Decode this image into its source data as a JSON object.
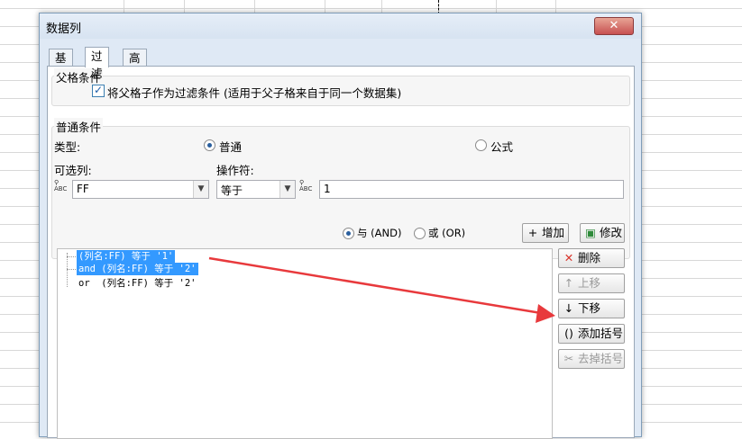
{
  "dialog": {
    "title": "数据列",
    "close_label": "✕"
  },
  "tabs": [
    {
      "label": "基本"
    },
    {
      "label": "过滤"
    },
    {
      "label": "高级"
    }
  ],
  "parent_condition": {
    "legend": "父格条件",
    "checkbox_checked": true,
    "checkbox_label": "将父格子作为过滤条件 (适用于父子格来自于同一个数据集)"
  },
  "normal_condition": {
    "legend": "普通条件",
    "type_label": "类型:",
    "type_options": [
      {
        "label": "普通",
        "selected": true
      },
      {
        "label": "公式",
        "selected": false
      }
    ],
    "column_label": "可选列:",
    "column_value": "FF",
    "operator_label": "操作符:",
    "operator_value": "等于",
    "value_value": "1"
  },
  "logic": {
    "and_label": "与 (AND)",
    "and_selected": true,
    "or_label": "或 (OR)",
    "or_selected": false
  },
  "buttons": {
    "add": "增加",
    "modify": "修改",
    "delete": "删除",
    "move_up": "上移",
    "move_down": "下移",
    "add_bracket": "添加括号",
    "remove_bracket": "去掉括号"
  },
  "conditions": [
    {
      "connector": "",
      "text": "(列名:FF) 等于 '1'",
      "selected": true
    },
    {
      "connector": "",
      "text": "and (列名:FF) 等于 '2'",
      "selected": true
    },
    {
      "connector": "",
      "text": "or  (列名:FF) 等于 '2'",
      "selected": false
    }
  ],
  "colors": {
    "accent": "#3399ff",
    "arrow": "#e8393c"
  }
}
